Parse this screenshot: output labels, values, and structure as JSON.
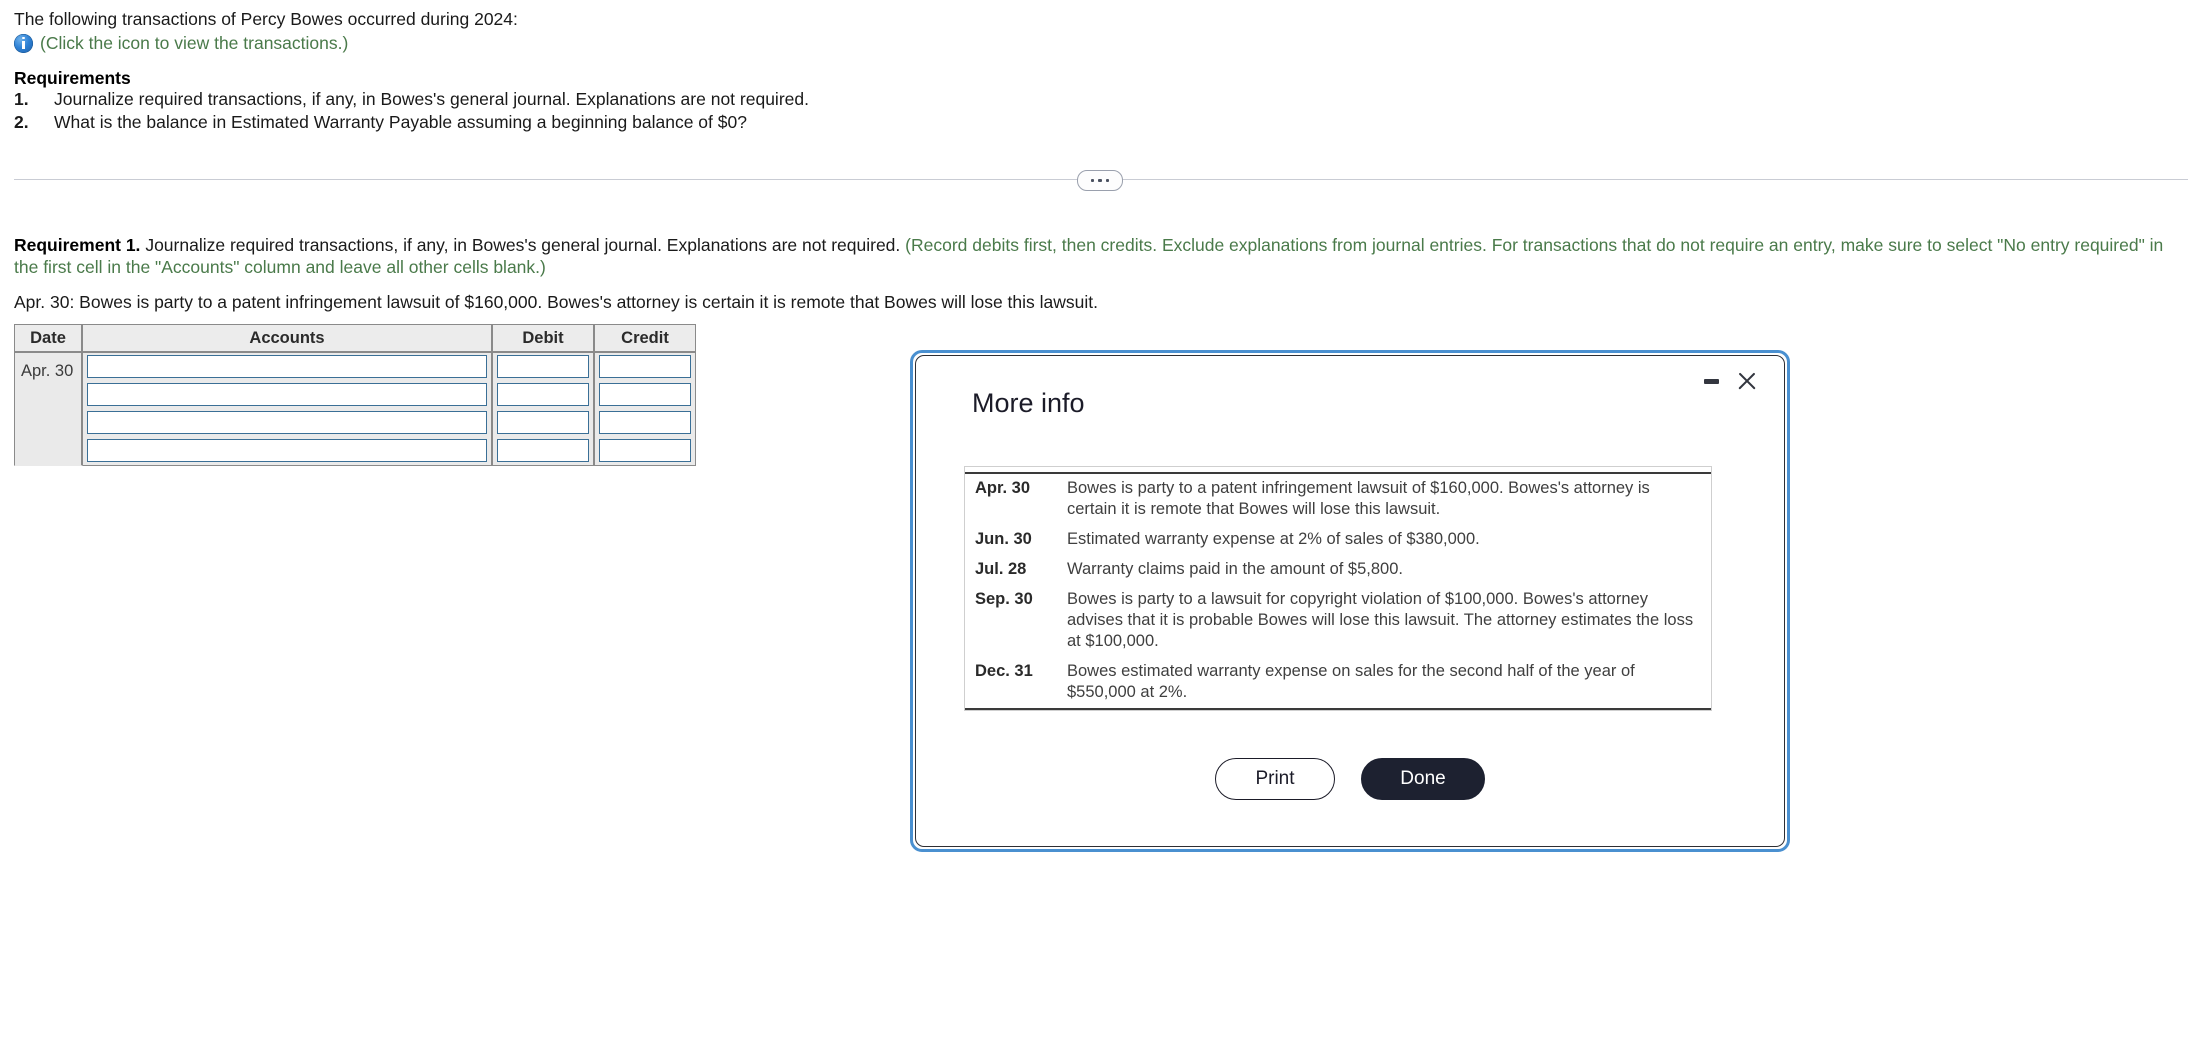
{
  "problem": {
    "intro": "The following transactions of Percy Bowes occurred during 2024:",
    "icon_link": "(Click the icon to view the transactions.)",
    "icon_name": "info-icon",
    "requirements_heading": "Requirements",
    "requirements": [
      {
        "num": "1.",
        "text": "Journalize required transactions, if any, in Bowes's general journal. Explanations are not required."
      },
      {
        "num": "2.",
        "text": "What is the balance in Estimated Warranty Payable assuming a beginning balance of $0?"
      }
    ]
  },
  "divider": {
    "more_label": "•••"
  },
  "requirement_block": {
    "label": "Requirement 1.",
    "body": "Journalize required transactions, if any, in Bowes's general journal. Explanations are not required.",
    "parenthetical": "(Record debits first, then credits. Exclude explanations from journal entries. For transactions that do not require an entry, make sure to select \"No entry required\" in the first cell in the \"Accounts\" column and leave all other cells blank.)",
    "scenario": "Apr. 30: Bowes is party to a patent infringement lawsuit of $160,000. Bowes's attorney is certain it is remote that Bowes will lose this lawsuit."
  },
  "journal": {
    "columns": [
      "Date",
      "Accounts",
      "Debit",
      "Credit"
    ],
    "rows": [
      {
        "date": "Apr. 30",
        "accounts": "",
        "debit": "",
        "credit": ""
      },
      {
        "date": "",
        "accounts": "",
        "debit": "",
        "credit": ""
      },
      {
        "date": "",
        "accounts": "",
        "debit": "",
        "credit": ""
      },
      {
        "date": "",
        "accounts": "",
        "debit": "",
        "credit": ""
      }
    ]
  },
  "modal": {
    "title": "More info",
    "minimize_label": "minimize",
    "close_label": "close",
    "transactions": [
      {
        "date": "Apr. 30",
        "description": "Bowes is party to a patent infringement lawsuit of $160,000. Bowes's attorney is certain it is remote that Bowes will lose this lawsuit."
      },
      {
        "date": "Jun. 30",
        "description": "Estimated warranty expense at 2% of sales of $380,000."
      },
      {
        "date": "Jul. 28",
        "description": "Warranty claims paid in the amount of $5,800."
      },
      {
        "date": "Sep. 30",
        "description": "Bowes is party to a lawsuit for copyright violation of $100,000. Bowes's attorney advises that it is probable Bowes will lose this lawsuit. The attorney estimates the loss at $100,000."
      },
      {
        "date": "Dec. 31",
        "description": "Bowes estimated warranty expense on sales for the second half of the year of $550,000 at 2%."
      }
    ],
    "print_label": "Print",
    "done_label": "Done"
  },
  "colors": {
    "link_green": "#4a7a4a",
    "modal_border_blue": "#4a90d0",
    "done_button_bg": "#1d2130",
    "input_border": "#3a6f96",
    "table_header_bg": "#ececec"
  }
}
